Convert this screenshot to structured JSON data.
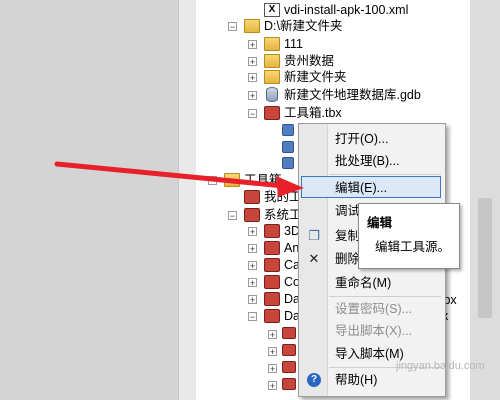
{
  "tree": {
    "items": [
      {
        "label": "vdi-install-apk-100.xml",
        "icon": "xml-file-icon"
      },
      {
        "label": "D:\\新建文件夹",
        "icon": "folder-icon"
      },
      {
        "label": "111",
        "icon": "folder-icon"
      },
      {
        "label": "贵州数据",
        "icon": "folder-icon"
      },
      {
        "label": "新建文件夹",
        "icon": "folder-icon"
      },
      {
        "label": "新建文件地理数据库.gdb",
        "icon": "geodatabase-icon"
      },
      {
        "label": "工具箱.tbx",
        "icon": "toolbox-icon"
      },
      {
        "label": "工具箱",
        "icon": "toolbox-folder-icon"
      },
      {
        "label": "我的工",
        "icon": "toolbox-icon"
      },
      {
        "label": "系统工",
        "icon": "toolbox-icon"
      },
      {
        "label": "3D",
        "icon": "toolbox-icon"
      },
      {
        "label": "An",
        "icon": "toolbox-icon"
      },
      {
        "label": "Ca",
        "icon": "toolbox-icon"
      },
      {
        "label": "Co",
        "icon": "toolbox-icon"
      },
      {
        "label": "Da",
        "icon": "toolbox-icon"
      },
      {
        "label": "Da",
        "icon": "toolbox-icon"
      }
    ],
    "partial_labels": {
      "tbx_suffix": "tbx",
      "x_suffix": "x"
    }
  },
  "context_menu": {
    "items": [
      {
        "label": "打开(O)...",
        "enabled": true
      },
      {
        "label": "批处理(B)...",
        "enabled": true
      },
      {
        "label": "编辑(E)...",
        "enabled": true,
        "highlighted": true
      },
      {
        "label": "调试(",
        "enabled": true
      },
      {
        "label": "复制(",
        "enabled": true,
        "icon": "copy-icon"
      },
      {
        "label": "删除(",
        "enabled": true,
        "icon": "delete-icon"
      },
      {
        "label": "重命名(M)",
        "enabled": true
      },
      {
        "label": "设置密码(S)...",
        "enabled": false
      },
      {
        "label": "导出脚本(X)...",
        "enabled": false
      },
      {
        "label": "导入脚本(M)",
        "enabled": true
      },
      {
        "label": "帮助(H)",
        "enabled": true,
        "icon": "help-icon"
      }
    ]
  },
  "tooltip": {
    "title": "编辑",
    "description": "编辑工具源。"
  },
  "colors": {
    "arrow": "#e8202a",
    "highlight_border": "#3b78c8",
    "highlight_bg": "#dbe8f8"
  },
  "watermark": "jingyan.baidu.com"
}
